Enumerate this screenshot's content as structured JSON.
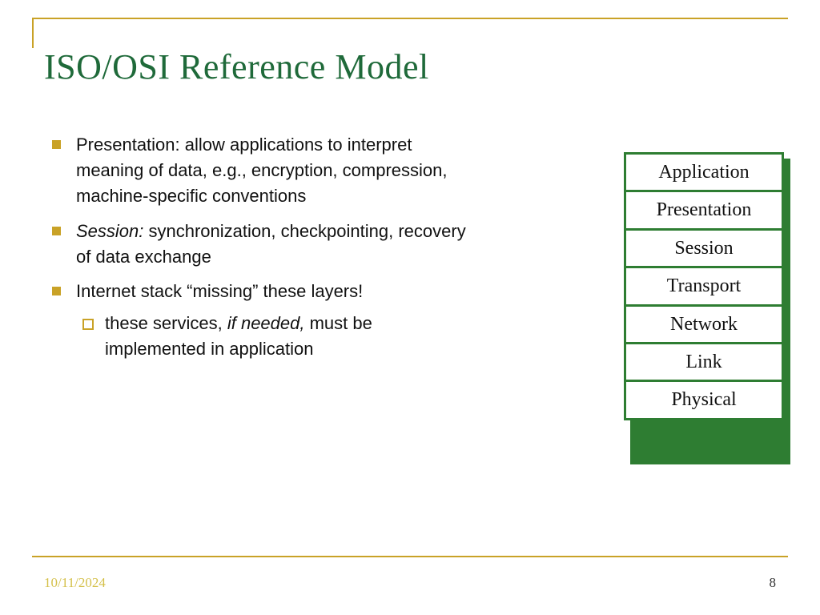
{
  "title": "ISO/OSI Reference Model",
  "bullets": {
    "b1_lead": "Presentation:",
    "b1_rest": " allow applications to interpret meaning of data, e.g., encryption, compression, machine-specific conventions",
    "b2_lead": "Session:",
    "b2_rest": " synchronization, checkpointing, recovery of data exchange",
    "b3": "Internet stack “missing” these layers!",
    "b3_sub_a": "these services, ",
    "b3_sub_em": "if needed,",
    "b3_sub_b": " must be implemented in application"
  },
  "layers": {
    "l1": "Application",
    "l2": "Presentation",
    "l3": "Session",
    "l4": "Transport",
    "l5": "Network",
    "l6": "Link",
    "l7": "Physical"
  },
  "footer": {
    "date": "10/11/2024",
    "page": "8"
  }
}
